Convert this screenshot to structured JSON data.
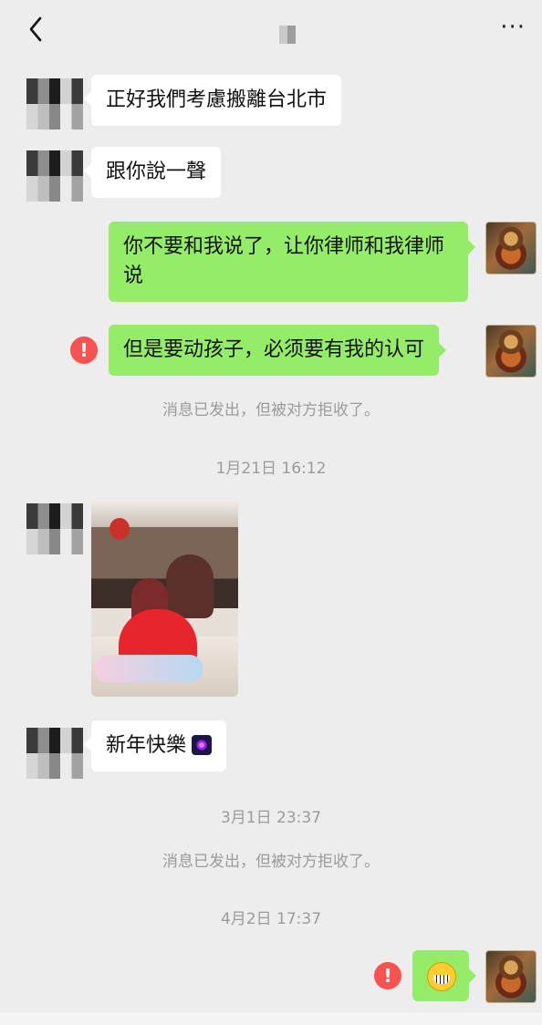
{
  "header": {
    "back_icon": "chevron-left-icon",
    "title": "",
    "more_label": "···"
  },
  "messages": [
    {
      "side": "left",
      "text": "正好我們考慮搬離台北市"
    },
    {
      "side": "left",
      "text": "跟你說一聲"
    },
    {
      "side": "right",
      "text": "你不要和我说了，让你律师和我律师说"
    },
    {
      "side": "right",
      "text": "但是要动孩子，必须要有我的认可",
      "status": "failed"
    },
    {
      "side": "left",
      "type": "image"
    },
    {
      "side": "left",
      "text": "新年快樂",
      "emoji": "fireworks"
    },
    {
      "side": "right",
      "type": "emoji",
      "emoji": "grinning-face",
      "status": "failed"
    }
  ],
  "system": {
    "rejected": "消息已发出，但被对方拒收了。",
    "time1": "1月21日 16:12",
    "time2": "3月1日 23:37",
    "time3": "4月2日 17:37"
  },
  "icons": {
    "warning": "!"
  },
  "colors": {
    "background": "#ededed",
    "sent_bubble": "#95ec69",
    "received_bubble": "#ffffff",
    "warning": "#fa5151",
    "system_text": "#9b9b9b"
  }
}
